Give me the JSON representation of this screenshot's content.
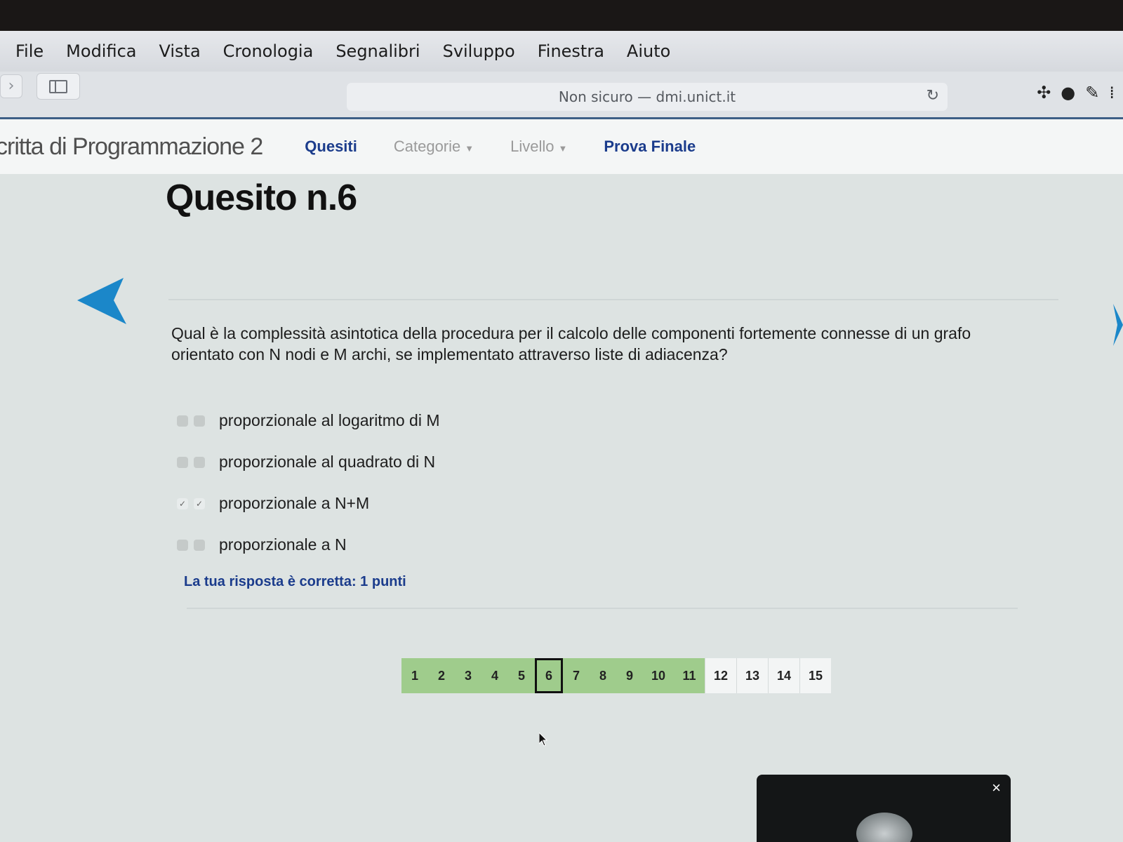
{
  "menubar": {
    "items": [
      "File",
      "Modifica",
      "Vista",
      "Cronologia",
      "Segnalibri",
      "Sviluppo",
      "Finestra",
      "Aiuto"
    ]
  },
  "toolbar": {
    "url_text": "Non sicuro — dmi.unict.it",
    "icons": [
      "back-icon",
      "sidebar-icon",
      "reload-icon",
      "dropbox-icon",
      "dark-mode-icon",
      "pen-icon",
      "extension-icon"
    ]
  },
  "site_nav": {
    "title": "critta di Programmazione 2",
    "links": {
      "quesiti": "Quesiti",
      "categorie": "Categorie",
      "livello": "Livello",
      "prova_finale": "Prova Finale"
    }
  },
  "main": {
    "title": "Quesito n.6",
    "question": "Qual è la complessità asintotica della procedura per il calcolo delle componenti fortemente connesse di un grafo orientato con N nodi e M archi, se implementato attraverso liste di adiacenza?",
    "options": [
      {
        "label": "proporzionale al logaritmo di M",
        "checked": false
      },
      {
        "label": "proporzionale al quadrato di N",
        "checked": false
      },
      {
        "label": "proporzionale a N+M",
        "checked": true
      },
      {
        "label": "proporzionale a N",
        "checked": false
      }
    ],
    "feedback": "La tua risposta è corretta: 1 punti",
    "check_mark": "✓"
  },
  "pagination": {
    "pages": [
      "1",
      "2",
      "3",
      "4",
      "5",
      "6",
      "7",
      "8",
      "9",
      "10",
      "11",
      "12",
      "13",
      "14",
      "15"
    ],
    "current": "6",
    "answered_through": 11,
    "answered_color": "#9fcc8c"
  },
  "video_panel": {
    "close_label": "×"
  },
  "colors": {
    "accent": "#1b3c8c",
    "arrow": "#1b87c9"
  }
}
